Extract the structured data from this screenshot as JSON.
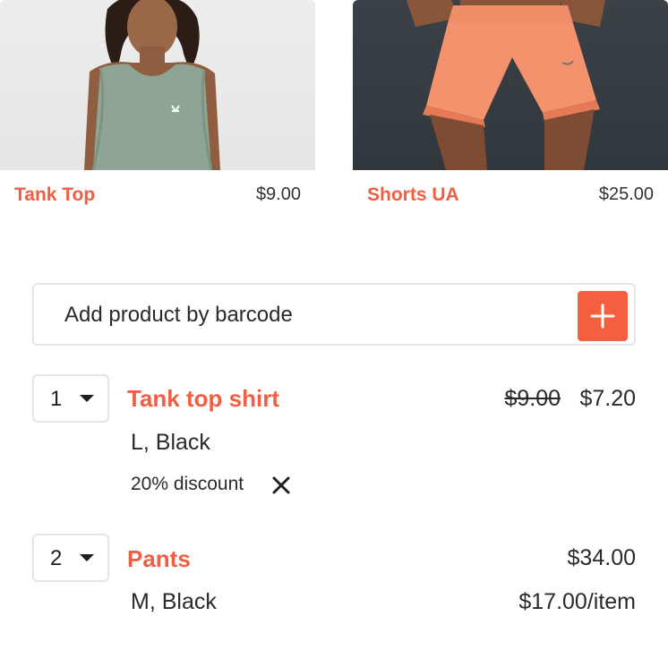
{
  "products": [
    {
      "name": "Tank Top",
      "price": "$9.00",
      "image": "tank-top-photo"
    },
    {
      "name": "Shorts UA",
      "price": "$25.00",
      "image": "orange-shorts-photo"
    }
  ],
  "barcode": {
    "placeholder": "Add product by barcode",
    "button_icon": "plus-icon"
  },
  "cart": {
    "lines": [
      {
        "quantity": "1",
        "name": "Tank top shirt",
        "variant": "L, Black",
        "original_price": "$9.00",
        "price": "$7.20",
        "discount": "20% discount"
      },
      {
        "quantity": "2",
        "name": "Pants",
        "variant": "M, Black",
        "price": "$34.00",
        "unit_price": "$17.00/item"
      }
    ]
  },
  "colors": {
    "accent": "#f4603f",
    "accent_text": "#f05f43",
    "border": "#e4e4e4"
  }
}
